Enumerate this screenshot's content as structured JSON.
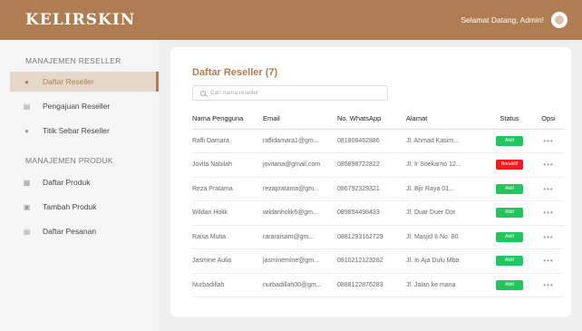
{
  "header": {
    "logo": "KELIRSKIN",
    "greeting": "Selamat Datang, Admin!"
  },
  "sidebar": {
    "section1": "MANAJEMEN RESELLER",
    "section2": "MANAJEMEN PRODUK",
    "items": [
      {
        "label": "Daftar Reseller",
        "icon": "person-icon"
      },
      {
        "label": "Pengajuan Reseller",
        "icon": "clipboard-icon"
      },
      {
        "label": "Titik Sebar Reseller",
        "icon": "people-icon"
      },
      {
        "label": "Daftar Produk",
        "icon": "grid-icon"
      },
      {
        "label": "Tambah Produk",
        "icon": "lock-icon"
      },
      {
        "label": "Daftar Pesanan",
        "icon": "list-icon"
      }
    ]
  },
  "main": {
    "title": "Daftar Reseller (7)",
    "search_placeholder": "Cari nama reseller",
    "columns": [
      "Nama Pengguna",
      "Email",
      "No. WhatsApp",
      "Alamat",
      "Status",
      "Opsi"
    ],
    "rows": [
      {
        "name": "Rafli Damara",
        "email": "raflidamara1@gm...",
        "phone": "081806462886",
        "address": "Jl. Ahmad Kasim...",
        "status": "Aktif",
        "status_color": "#22c55e"
      },
      {
        "name": "Jovita Nabilah",
        "email": "jovitana@gmail.com",
        "phone": "085898722822",
        "address": "Jl. Ir Soekarno 12...",
        "status": "Nonaktif",
        "status_color": "#ee1d1d"
      },
      {
        "name": "Reza Pratama",
        "email": "rezapratama@gm...",
        "phone": "086792329321",
        "address": "Jl. Bjir Raya 01...",
        "status": "Aktif",
        "status_color": "#22c55e"
      },
      {
        "name": "Wildan Holik",
        "email": "wildanholik6@gm...",
        "phone": "089854498433",
        "address": "Jl. Duar Duer Dor",
        "status": "Aktif",
        "status_color": "#22c55e"
      },
      {
        "name": "Raisa Mutia",
        "email": "rararaisam@gm...",
        "phone": "0881293162729",
        "address": "Jl. Masjid II No. 80",
        "status": "Aktif",
        "status_color": "#22c55e"
      },
      {
        "name": "Jasmine Aulia",
        "email": "jasminemine@gm...",
        "phone": "0810212123282",
        "address": "Jl. In Aja Dulu Mba",
        "status": "Aktif",
        "status_color": "#22c55e"
      },
      {
        "name": "Nurbadillah",
        "email": "nurbadillah00@gm...",
        "phone": "0888122876283",
        "address": "Jl. Jalan ke mana",
        "status": "Aktif",
        "status_color": "#22c55e"
      }
    ],
    "options_glyph": "•••"
  },
  "colors": {
    "brand": "#b07d52",
    "active_bg": "#e5d7c9",
    "status_active": "#22c55e",
    "status_inactive": "#ee1d1d"
  }
}
